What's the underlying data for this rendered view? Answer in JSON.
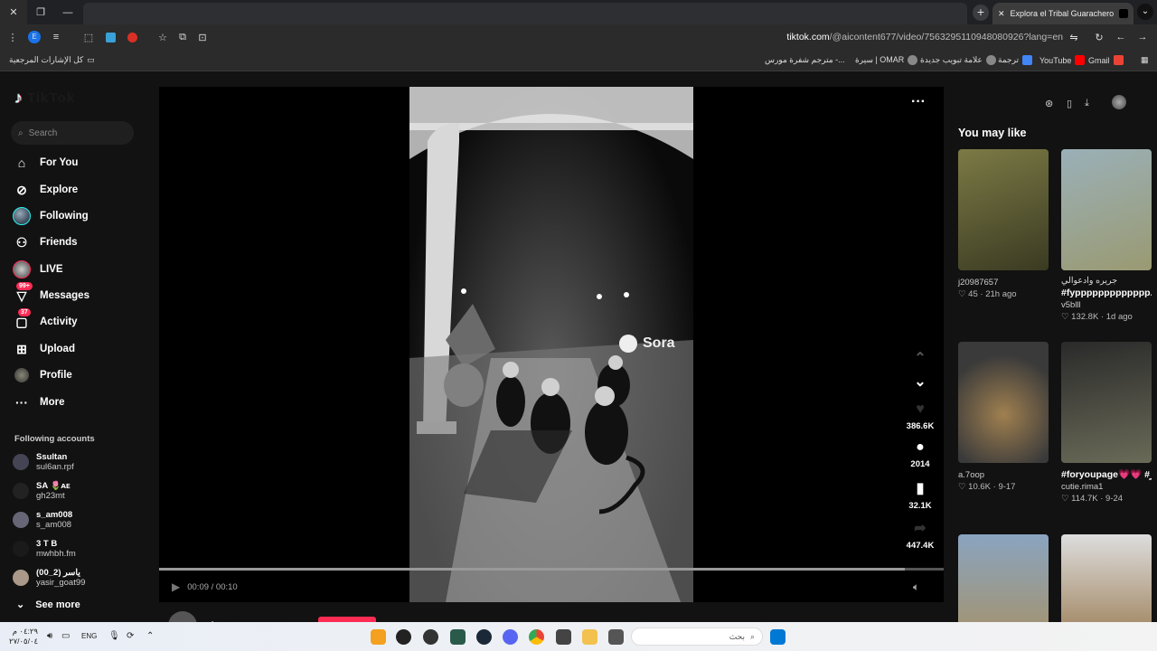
{
  "browser": {
    "tab_title": "Explora el Tribal Guarachero: R",
    "new_tab": "+",
    "url_domain": "tiktok.com",
    "url_path": "/@aicontent677/video/7563295110948080926?lang=en",
    "bookmarks": [
      {
        "label": "كل الإشارات المرجعية",
        "color": "#ddd"
      },
      {
        "label": "Gmail",
        "color": "#ea4335"
      },
      {
        "label": "YouTube",
        "color": "#ff0000"
      },
      {
        "label": "ترجمة",
        "color": "#4285f4"
      },
      {
        "label": "علامة تبويب جديدة",
        "color": "#888"
      },
      {
        "label": "سيرة | OMAR",
        "color": "#888"
      },
      {
        "label": "مترجم شفرة مورس -...",
        "color": "#888"
      }
    ]
  },
  "sidebar": {
    "logo": "TikTok",
    "search_placeholder": "Search",
    "nav": [
      {
        "label": "For You",
        "icon": "home-icon"
      },
      {
        "label": "Explore",
        "icon": "compass-icon"
      },
      {
        "label": "Following",
        "icon": "following-avatar"
      },
      {
        "label": "Friends",
        "icon": "friends-icon"
      },
      {
        "label": "LIVE",
        "icon": "live-icon"
      },
      {
        "label": "Messages",
        "icon": "messages-icon",
        "badge": "99+"
      },
      {
        "label": "Activity",
        "icon": "activity-icon",
        "badge": "37"
      },
      {
        "label": "Upload",
        "icon": "upload-icon"
      },
      {
        "label": "Profile",
        "icon": "profile-avatar"
      },
      {
        "label": "More",
        "icon": "more-icon"
      }
    ],
    "following_title": "Following accounts",
    "accounts": [
      {
        "name": "Ssultan",
        "handle": "sul6an.rpf"
      },
      {
        "name": "SA 🌷ᴀᴇ",
        "handle": "gh23mt"
      },
      {
        "name": "s_am008",
        "handle": "s_am008"
      },
      {
        "name": "3 T B",
        "handle": "mwhbh.fm"
      },
      {
        "name": "ياسر (2_00)",
        "handle": "yasir_goat99"
      }
    ],
    "see_more": "See more"
  },
  "video": {
    "watermark": "Sora",
    "likes": "386.6K",
    "comments": "2014",
    "saves": "32.1K",
    "shares": "447.4K",
    "time": "00:09 / 00:10",
    "progress": 0.95,
    "author": "aicontent677"
  },
  "right": {
    "title": "You may like",
    "cards": [
      {
        "caption": "",
        "bold": "",
        "user": "j20987657",
        "likes": "45",
        "age": "21h ago",
        "color": "#6b6b3a"
      },
      {
        "caption": "جريره وادعوالي",
        "bold": "#fyppppppppppppp...",
        "user": "v5blll",
        "likes": "132.8K",
        "age": "1d ago",
        "color": "#8a8f6a"
      },
      {
        "caption": "",
        "bold": "",
        "user": "a.7oop",
        "likes": "10.6K",
        "age": "9-17",
        "color": "#6a5a3a"
      },
      {
        "caption": "",
        "bold": "#foryoupage💗💗 #اكسبلور",
        "user": "cutie.rima1",
        "likes": "114.7K",
        "age": "9-24",
        "color": "#4a4a3a"
      },
      {
        "caption": "",
        "bold": "",
        "user": "",
        "likes": "",
        "age": "",
        "color": "#7a8a9a"
      },
      {
        "caption": "",
        "bold": "",
        "user": "",
        "likes": "",
        "age": "",
        "color": "#9a8a7a"
      }
    ]
  },
  "taskbar": {
    "time": "٠٤:٢٩ م",
    "date": "٢٧/٠٥/٠٤",
    "lang": "ENG",
    "search": "بحث"
  }
}
